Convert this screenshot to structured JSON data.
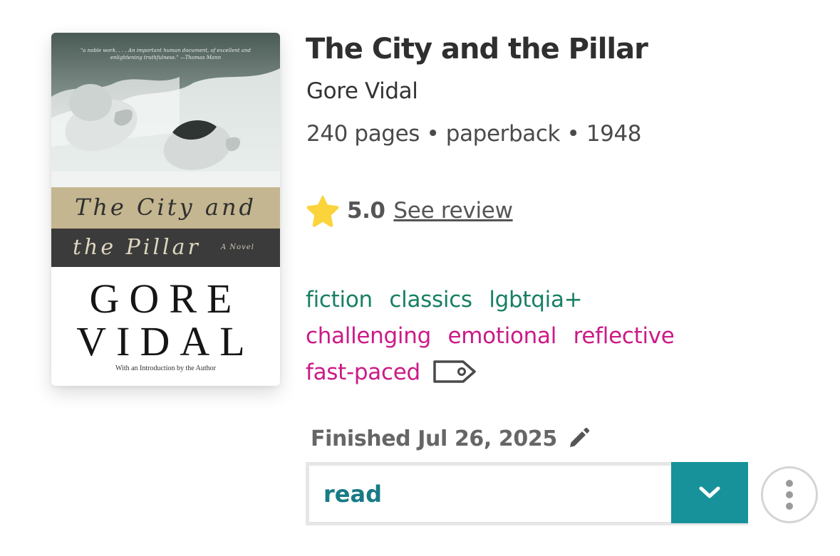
{
  "book": {
    "title": "The City and the Pillar",
    "author": "Gore Vidal",
    "meta": "240 pages • paperback • 1948"
  },
  "cover": {
    "quote": "\"a noble work. . . . An important human document, of excellent and enlightening truthfulness.\" —Thomas Mann",
    "title_line1": "The City and",
    "title_line2": "the Pillar",
    "subtitle": "A Novel",
    "author_line1": "GORE",
    "author_line2": "VIDAL",
    "intro": "With an Introduction by the Author"
  },
  "rating": {
    "value": "5.0",
    "fraction": 1.0,
    "review_link": "See review",
    "star_icon": "star-icon",
    "star_color": "#fbd43c"
  },
  "tags": {
    "genres": [
      "fiction",
      "classics",
      "lgbtqia+"
    ],
    "moods": [
      "challenging",
      "emotional",
      "reflective"
    ],
    "pace": [
      "fast-paced"
    ],
    "genre_color": "#188064",
    "mood_color": "#cc1a87",
    "tag_icon": "tag-icon"
  },
  "progress": {
    "finished_text": "Finished Jul 26, 2025",
    "edit_icon": "pencil-icon"
  },
  "status": {
    "value": "read",
    "dropdown_icon": "chevron-down-icon",
    "accent_color": "#17929a",
    "more_icon": "more-vertical-icon"
  }
}
